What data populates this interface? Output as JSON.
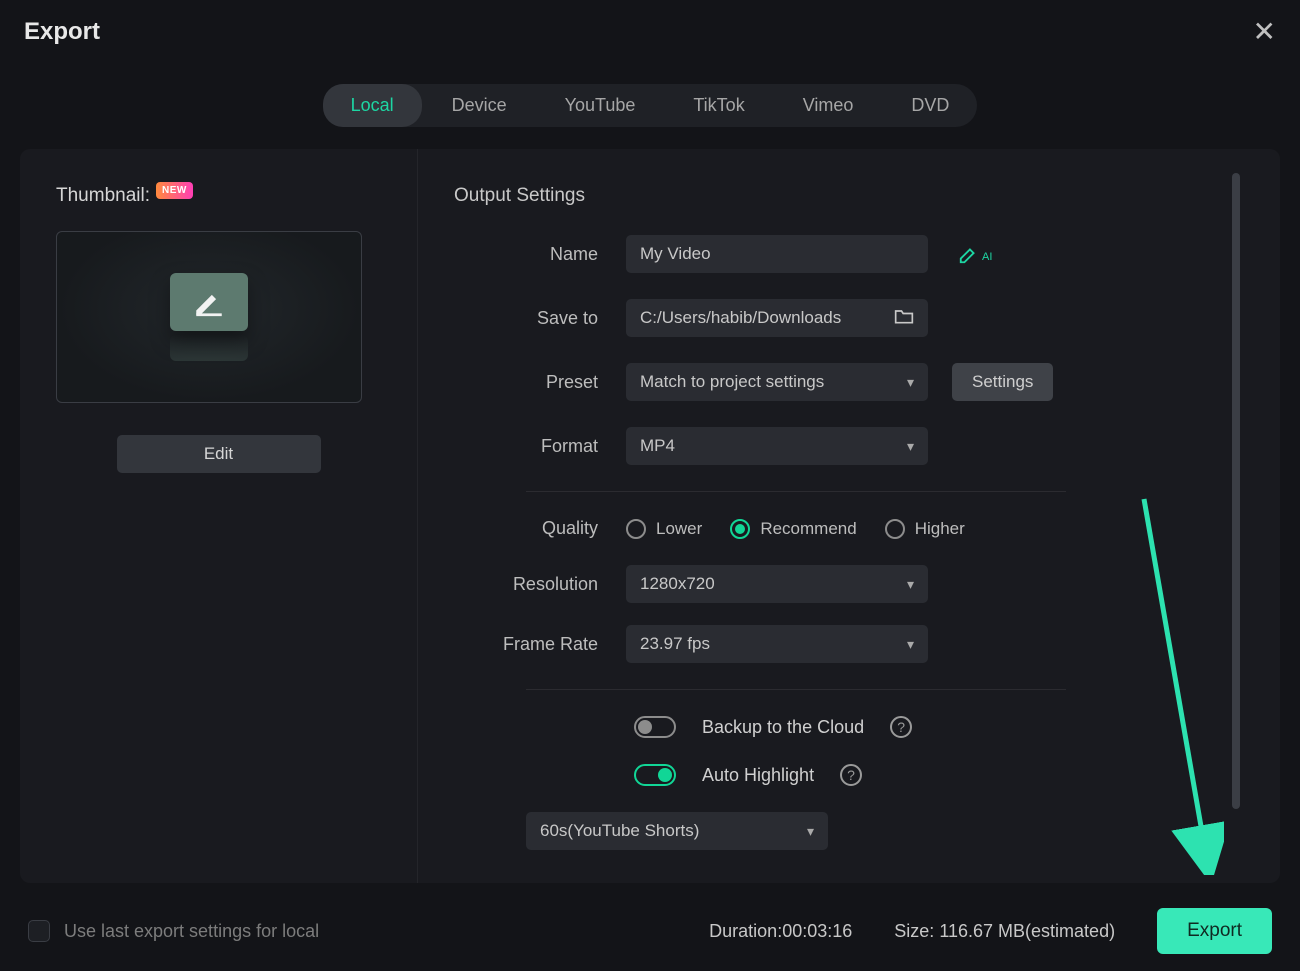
{
  "window": {
    "title": "Export"
  },
  "tabs": [
    "Local",
    "Device",
    "YouTube",
    "TikTok",
    "Vimeo",
    "DVD"
  ],
  "active_tab": 0,
  "thumbnail": {
    "label": "Thumbnail:",
    "badge": "NEW",
    "edit": "Edit"
  },
  "output": {
    "section_title": "Output Settings",
    "name_label": "Name",
    "name_value": "My Video",
    "ai_suffix": "AI",
    "saveto_label": "Save to",
    "saveto_value": "C:/Users/habib/Downloads",
    "preset_label": "Preset",
    "preset_value": "Match to project settings",
    "settings_btn": "Settings",
    "format_label": "Format",
    "format_value": "MP4",
    "quality_label": "Quality",
    "quality_options": [
      "Lower",
      "Recommend",
      "Higher"
    ],
    "quality_selected": 1,
    "resolution_label": "Resolution",
    "resolution_value": "1280x720",
    "framerate_label": "Frame Rate",
    "framerate_value": "23.97 fps",
    "backup_label": "Backup to the Cloud",
    "backup_on": false,
    "autohighlight_label": "Auto Highlight",
    "autohighlight_on": true,
    "autohighlight_preset": "60s(YouTube Shorts)"
  },
  "footer": {
    "checkbox_label": "Use last export settings for local",
    "duration_label": "Duration:",
    "duration_value": "00:03:16",
    "size_label": "Size:",
    "size_value": "116.67 MB(estimated)",
    "export_btn": "Export"
  },
  "colors": {
    "accent": "#11d696"
  }
}
